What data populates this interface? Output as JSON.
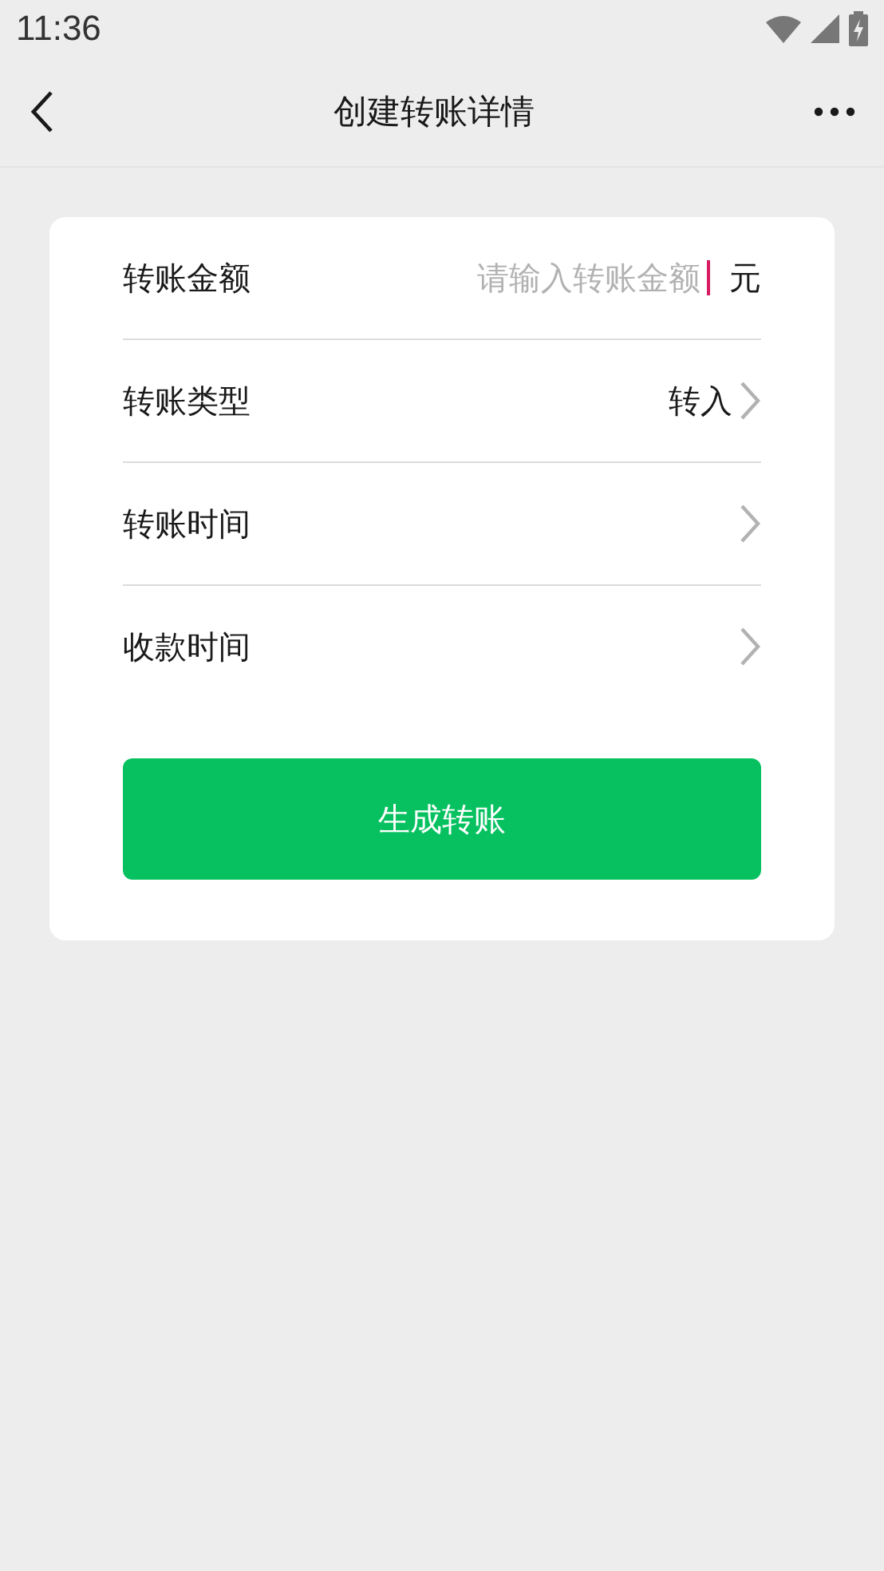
{
  "status_bar": {
    "time": "11:36"
  },
  "nav": {
    "title": "创建转账详情"
  },
  "form": {
    "rows": [
      {
        "kind": "input",
        "label": "转账金额",
        "placeholder": "请输入转账金额",
        "focused": true,
        "unit": "元"
      },
      {
        "kind": "select",
        "label": "转账类型",
        "value": "转入"
      },
      {
        "kind": "select",
        "label": "转账时间"
      },
      {
        "kind": "select",
        "label": "收款时间"
      }
    ],
    "submit": "生成转账"
  }
}
